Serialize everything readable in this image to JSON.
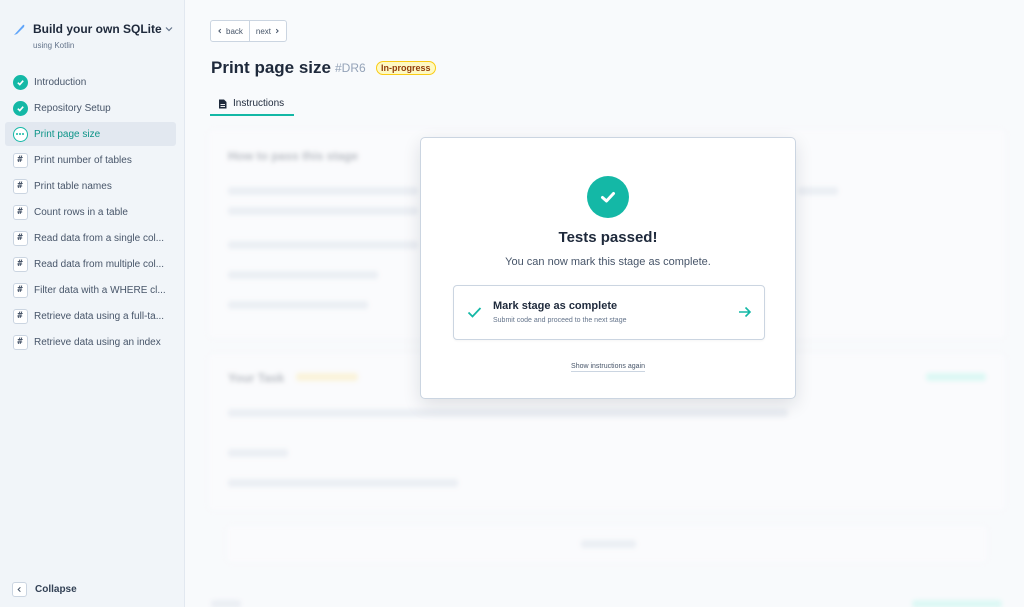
{
  "sidebar": {
    "course_title": "Build your own SQLite",
    "course_subtitle": "using Kotlin",
    "stages": [
      {
        "label": "Introduction",
        "status": "complete"
      },
      {
        "label": "Repository Setup",
        "status": "complete"
      },
      {
        "label": "Print page size",
        "status": "in-progress"
      },
      {
        "label": "Print number of tables",
        "status": "pending"
      },
      {
        "label": "Print table names",
        "status": "pending"
      },
      {
        "label": "Count rows in a table",
        "status": "pending"
      },
      {
        "label": "Read data from a single col...",
        "status": "pending"
      },
      {
        "label": "Read data from multiple col...",
        "status": "pending"
      },
      {
        "label": "Filter data with a WHERE cl...",
        "status": "pending"
      },
      {
        "label": "Retrieve data using a full-ta...",
        "status": "pending"
      },
      {
        "label": "Retrieve data using an index",
        "status": "pending"
      }
    ],
    "collapse_label": "Collapse"
  },
  "nav": {
    "back_label": "back",
    "next_label": "next"
  },
  "header": {
    "title": "Print page size",
    "stage_code": "#DR6",
    "status_badge": "In-progress"
  },
  "tabs": [
    {
      "label": "Instructions"
    }
  ],
  "background": {
    "pass_stage_heading": "How to pass this stage",
    "task_heading": "Your Task",
    "task_badge": "In-progress"
  },
  "modal": {
    "title": "Tests passed!",
    "subtitle": "You can now mark this stage as complete.",
    "cta_title": "Mark stage as complete",
    "cta_subtitle": "Submit code and proceed to the next stage",
    "show_again": "Show instructions again"
  },
  "colors": {
    "accent": "#14b8a6",
    "badge_bg": "#fef9c3"
  }
}
